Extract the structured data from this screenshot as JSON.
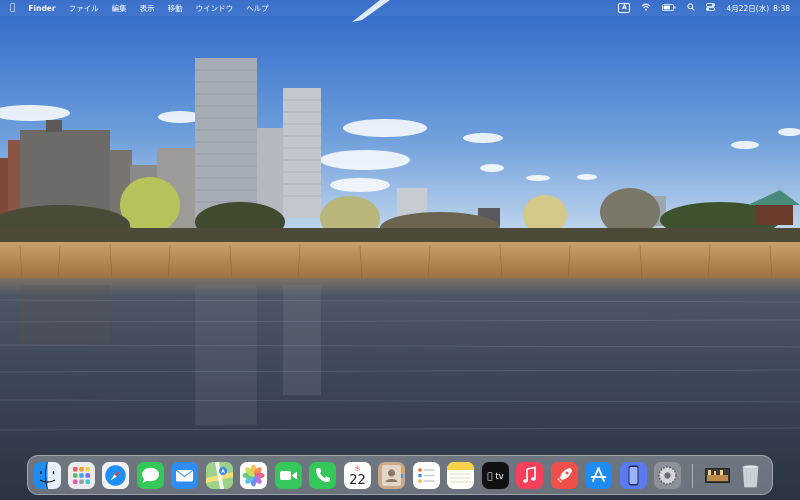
{
  "menubar": {
    "apple_icon": "apple-logo-icon",
    "app_name": "Finder",
    "menus": [
      "ファイル",
      "編集",
      "表示",
      "移動",
      "ウインドウ",
      "ヘルプ"
    ],
    "input_source": "A",
    "status_icons": [
      "wifi-icon",
      "battery-icon",
      "spotlight-search-icon",
      "control-center-icon"
    ],
    "date": "4月22日(水)",
    "time": "8:38"
  },
  "dock": {
    "apps": [
      {
        "name": "Finder",
        "icon": "finder-icon",
        "running": true
      },
      {
        "name": "Launchpad",
        "icon": "launchpad-icon"
      },
      {
        "name": "Safari",
        "icon": "safari-icon"
      },
      {
        "name": "Messages",
        "icon": "messages-icon"
      },
      {
        "name": "Mail",
        "icon": "mail-icon"
      },
      {
        "name": "Maps",
        "icon": "maps-icon"
      },
      {
        "name": "Photos",
        "icon": "photos-icon"
      },
      {
        "name": "FaceTime",
        "icon": "facetime-icon"
      },
      {
        "name": "Phone",
        "icon": "phone-icon"
      },
      {
        "name": "Calendar",
        "icon": "calendar-icon",
        "text": "22",
        "subtext": "水"
      },
      {
        "name": "Contacts",
        "icon": "contacts-icon"
      },
      {
        "name": "Reminders",
        "icon": "reminders-icon"
      },
      {
        "name": "Notes",
        "icon": "notes-icon"
      },
      {
        "name": "Apple TV",
        "icon": "apple-tv-icon",
        "text": "tv"
      },
      {
        "name": "Music",
        "icon": "music-icon"
      },
      {
        "name": "Rocket",
        "icon": "rocket-icon"
      },
      {
        "name": "App Store",
        "icon": "app-store-icon"
      },
      {
        "name": "iPhone Mirroring",
        "icon": "iphone-mirroring-icon"
      },
      {
        "name": "System Settings",
        "icon": "system-settings-icon"
      }
    ],
    "trailing": [
      {
        "name": "Recent Folder Stack",
        "icon": "image-stack-icon"
      },
      {
        "name": "Trash",
        "icon": "trash-icon"
      }
    ]
  },
  "wallpaper": {
    "description_colors": {
      "sky_top": "#2f6fcf",
      "sky_bottom": "#c8dcf0",
      "reeds": "#b98a4e",
      "water": "#3a4452"
    }
  }
}
